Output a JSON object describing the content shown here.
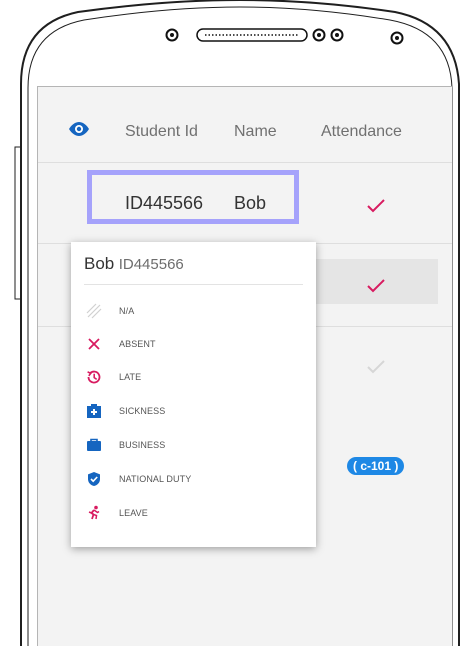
{
  "table": {
    "headers": {
      "student_id": "Student Id",
      "name": "Name",
      "attendance": "Attendance"
    },
    "rows": [
      {
        "student_id": "ID445566",
        "name": "Bob"
      }
    ]
  },
  "popup": {
    "name": "Bob",
    "id": "ID445566",
    "options": [
      {
        "label": "N/A",
        "icon": "na-hatch-icon",
        "color": "#d0d0d0"
      },
      {
        "label": "ABSENT",
        "icon": "close-icon",
        "color": "#d81b60"
      },
      {
        "label": "LATE",
        "icon": "history-icon",
        "color": "#d81b60"
      },
      {
        "label": "SICKNESS",
        "icon": "medical-kit-icon",
        "color": "#1565c0"
      },
      {
        "label": "BUSINESS",
        "icon": "briefcase-icon",
        "color": "#1565c0"
      },
      {
        "label": "NATIONAL DUTY",
        "icon": "shield-check-icon",
        "color": "#1565c0"
      },
      {
        "label": "LEAVE",
        "icon": "running-person-icon",
        "color": "#d81b60"
      }
    ]
  },
  "badge": "( c-101 )",
  "colors": {
    "check_active": "#d81b60",
    "check_inactive": "#d6d6d6",
    "eye_icon": "#1565c0",
    "selection_outline": "#a5a2fb",
    "badge": "#1e88e5"
  }
}
